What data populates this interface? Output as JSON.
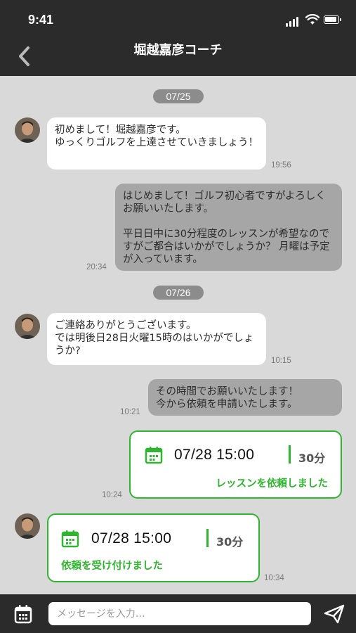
{
  "status_bar": {
    "time": "9:41"
  },
  "header": {
    "title": "堀越嘉彦コーチ"
  },
  "chat": {
    "date_1": "07/25",
    "date_2": "07/26",
    "messages": [
      {
        "sender": "coach",
        "text": "初めまして！堀越嘉彦です。\nゆっくりゴルフを上達させていきましょう！",
        "time": "19:56"
      },
      {
        "sender": "user",
        "text": "はじめまして！ゴルフ初心者ですがよろしくお願いいたします。\n\n平日日中に30分程度のレッスンが希望なのですがご都合はいかがでしょうか？ 月曜は予定が入っています。",
        "time": "20:34"
      },
      {
        "sender": "coach",
        "text": "ご連絡ありがとうございます。\nでは明後日28日火曜15時のはいかがでしょうか?",
        "time": "10:15"
      },
      {
        "sender": "user",
        "text": "その時間でお願いいたします！\n今から依頼を申請いたします。",
        "time": "10:21"
      }
    ],
    "lesson_request": {
      "datetime": "07/28 15:00",
      "duration": "30分",
      "status": "レッスンを依頼しました",
      "time": "10:24"
    },
    "lesson_accept": {
      "datetime": "07/28 15:00",
      "duration": "30分",
      "status": "依頼を受け付けました",
      "time": "10:34"
    }
  },
  "composer": {
    "placeholder": "メッセージを入力…"
  },
  "colors": {
    "accent_green": "#2fb52f",
    "bar_dark": "#2b2b2b",
    "chat_bg": "#d9d9d9",
    "out_bubble": "#a6a6a6"
  }
}
